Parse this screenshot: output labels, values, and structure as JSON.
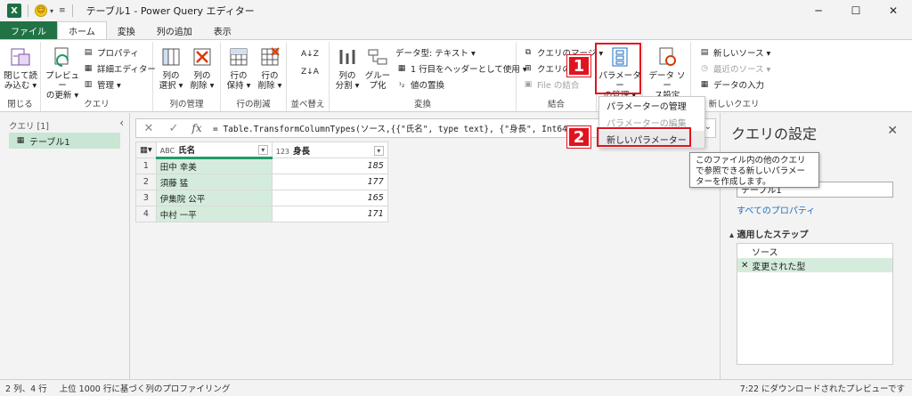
{
  "titlebar": {
    "app_icon": "X",
    "title": "テーブル1 - Power Query エディター",
    "minimize": "─",
    "maximize": "☐",
    "close": "✕"
  },
  "tabs": [
    {
      "label": "ファイル"
    },
    {
      "label": "ホーム"
    },
    {
      "label": "変換"
    },
    {
      "label": "列の追加"
    },
    {
      "label": "表示"
    }
  ],
  "ribbon": {
    "close_group": {
      "label": "閉じる",
      "close_load": "閉じて読\nみ込む ▾"
    },
    "query_group": {
      "label": "クエリ",
      "preview_refresh": "プレビュー\nの更新 ▾",
      "properties": "プロパティ",
      "advanced_editor": "詳細エディター",
      "manage": "管理 ▾"
    },
    "col_manage_group": {
      "label": "列の管理",
      "select_cols": "列の\n選択 ▾",
      "remove_cols": "列の\n削除 ▾"
    },
    "row_reduce_group": {
      "label": "行の削減",
      "keep_rows": "行の\n保持 ▾",
      "remove_rows": "行の\n削除 ▾"
    },
    "sort_group": {
      "label": "並べ替え"
    },
    "transform_group": {
      "label": "変換",
      "split_col": "列の\n分割 ▾",
      "group_by": "グルー\nプ化",
      "data_type": "データ型: テキスト ▾",
      "first_row_header": "1 行目をヘッダーとして使用 ▾",
      "replace_values": "値の置換"
    },
    "combine_group": {
      "label": "結合",
      "merge_queries": "クエリのマージ ▾",
      "append_queries": "クエリの",
      "combine_files": "File の結合"
    },
    "params_group": {
      "manage_params": "パラメーター\nの管理 ▾"
    },
    "datasource_group": {
      "label": "データ ソース",
      "datasource_settings": "データ ソー\nス設定"
    },
    "newquery_group": {
      "label": "新しいクエリ",
      "new_source": "新しいソース ▾",
      "recent_sources": "最近のソース ▾",
      "enter_data": "データの入力"
    }
  },
  "queries": {
    "header": "クエリ [1]",
    "items": [
      "テーブル1"
    ]
  },
  "formula": {
    "text": "= Table.TransformColumnTypes(ソース,{{\"氏名\", type text}, {\"身長\", Int64"
  },
  "grid": {
    "columns": [
      {
        "type": "ABC",
        "name": "氏名"
      },
      {
        "type": "123",
        "name": "身長"
      }
    ],
    "rows": [
      {
        "n": "1",
        "name": "田中 幸美",
        "height": "185"
      },
      {
        "n": "2",
        "name": "須藤 猛",
        "height": "177"
      },
      {
        "n": "3",
        "name": "伊集院 公平",
        "height": "165"
      },
      {
        "n": "4",
        "name": "中村 一平",
        "height": "171"
      }
    ]
  },
  "menu": {
    "items": [
      "パラメーターの管理",
      "パラメーターの編集",
      "新しいパラメーター"
    ]
  },
  "tooltip": {
    "text": "このファイル内の他のクエリで参照できる新しいパラメーターを作成します。"
  },
  "settings": {
    "title": "クエリの設定",
    "name_value": "テーブル1",
    "all_props": "すべてのプロパティ",
    "steps_header": "適用したステップ",
    "steps": [
      "ソース",
      "変更された型"
    ]
  },
  "badges": {
    "one": "1",
    "two": "2"
  },
  "status": {
    "left": "2 列、4 行",
    "mid": "上位 1000 行に基づく列のプロファイリング",
    "right": "7:22 にダウンロードされたプレビューです"
  },
  "colors": {
    "file_tab": "#217346",
    "accent_green": "#1e9e64",
    "highlight": "#e0141e",
    "selected": "#d5ecdc"
  }
}
